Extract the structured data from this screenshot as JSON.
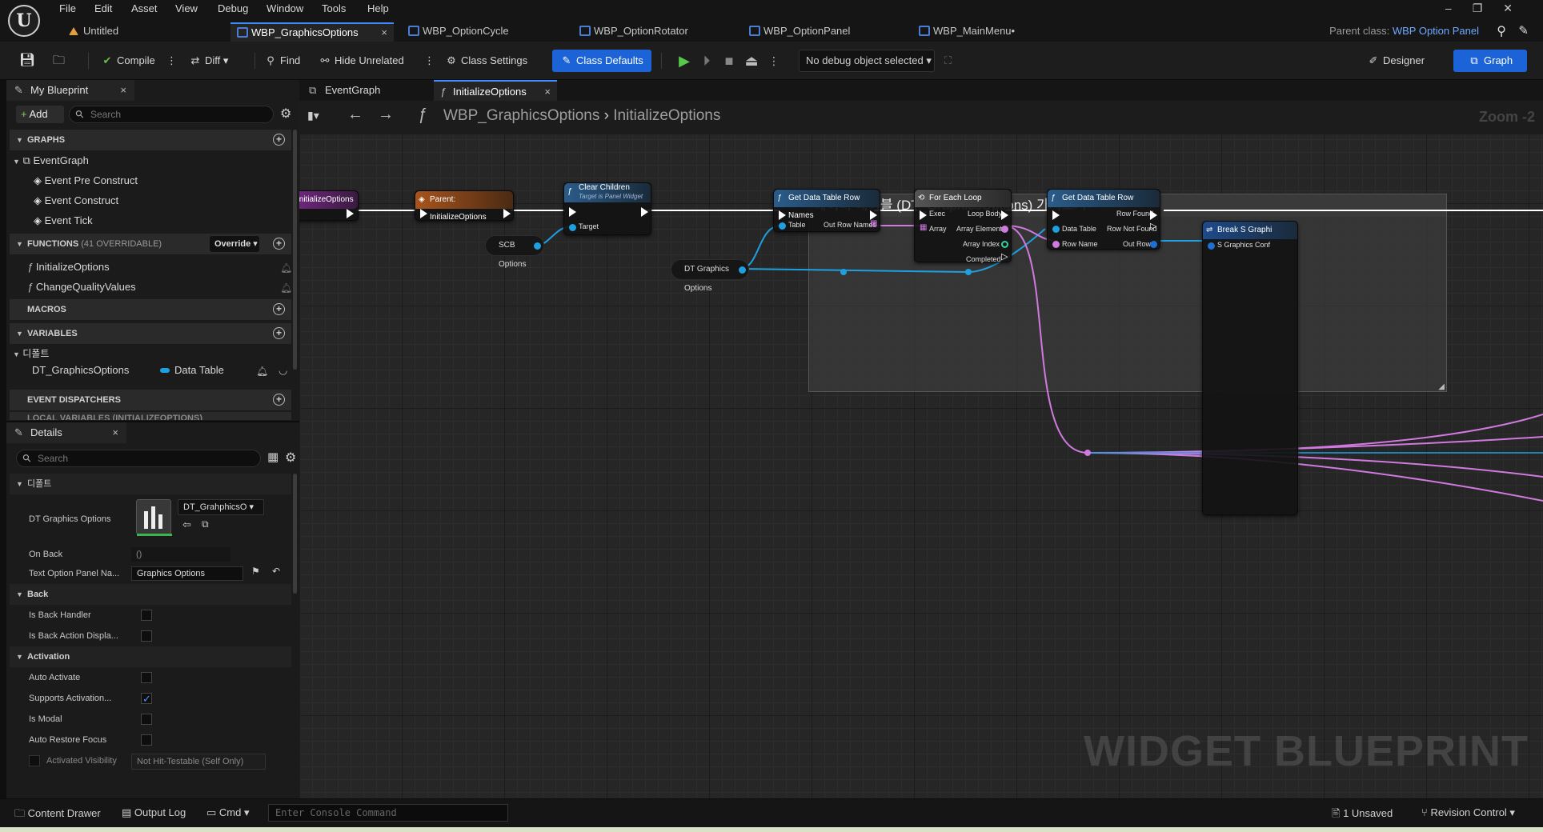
{
  "menu": [
    "File",
    "Edit",
    "Asset",
    "View",
    "Debug",
    "Window",
    "Tools",
    "Help"
  ],
  "doc_tabs": [
    {
      "label": "Untitled"
    },
    {
      "label": "WBP_GraphicsOptions"
    },
    {
      "label": "WBP_OptionCycle"
    },
    {
      "label": "WBP_OptionRotator"
    },
    {
      "label": "WBP_OptionPanel"
    },
    {
      "label": "WBP_MainMenu•"
    }
  ],
  "parent_class": {
    "label": "Parent class:",
    "value": "WBP Option Panel"
  },
  "toolbar": {
    "compile": "Compile",
    "diff": "Diff",
    "find": "Find",
    "hide_unrelated": "Hide Unrelated",
    "class_settings": "Class Settings",
    "class_defaults": "Class Defaults",
    "debug_object": "No debug object selected",
    "designer": "Designer",
    "graph": "Graph"
  },
  "my_blueprint": {
    "tab": "My Blueprint",
    "add": "Add",
    "search_placeholder": "Search",
    "graphs_header": "GRAPHS",
    "event_graph": "EventGraph",
    "events": [
      "Event Pre Construct",
      "Event Construct",
      "Event Tick"
    ],
    "functions_header": "FUNCTIONS",
    "functions_count": "(41 OVERRIDABLE)",
    "override": "Override",
    "functions": [
      "InitializeOptions",
      "ChangeQualityValues"
    ],
    "macros_header": "MACROS",
    "variables_header": "VARIABLES",
    "var_category": "디폴트",
    "variable_name": "DT_GraphicsOptions",
    "variable_type": "Data Table",
    "dispatchers_header": "EVENT DISPATCHERS",
    "local_vars_header": "LOCAL VARIABLES (INITIALIZEOPTIONS)"
  },
  "details": {
    "tab": "Details",
    "search_placeholder": "Search",
    "category_default": "디폴트",
    "dt_graphics_label": "DT Graphics Options",
    "dt_graphics_value": "DT_GrahphicsO",
    "on_back_label": "On Back",
    "on_back_value": "()",
    "text_panel_label": "Text Option Panel Na...",
    "text_panel_value": "Graphics Options",
    "back_header": "Back",
    "is_back_handler": "Is Back Handler",
    "is_back_action": "Is Back Action Displa...",
    "activation_header": "Activation",
    "auto_activate": "Auto Activate",
    "supports_activation": "Supports Activation...",
    "is_modal": "Is Modal",
    "auto_restore": "Auto Restore Focus",
    "activated_visibility": "Activated Visibility",
    "activated_visibility_value": "Not Hit-Testable (Self Only)",
    "checks": {
      "is_back_handler": false,
      "is_back_action": false,
      "auto_activate": false,
      "supports_activation": true,
      "is_modal": false,
      "auto_restore": false
    }
  },
  "graph_tabs": [
    "EventGraph",
    "InitializeOptions"
  ],
  "graph": {
    "breadcrumb_root": "WBP_GraphicsOptions",
    "breadcrumb_leaf": "InitializeOptions",
    "zoom": "Zoom -2",
    "watermark": "WIDGET BLUEPRINT",
    "comment": "데이터 테이블 (DT_GraphicsOptions) 가져오기",
    "nodes": {
      "entry": "InitializeOptions",
      "parent": "Parent: InitializeOptions",
      "clear_children": "Clear Children",
      "clear_children_sub": "Target is Panel Widget",
      "target": "Target",
      "scb_options": "SCB Options",
      "dt_graphics": "DT Graphics Options",
      "get_row_names": "Get Data Table Row Names",
      "table": "Table",
      "out_row_names": "Out Row Names",
      "for_each": "For Each Loop",
      "exec": "Exec",
      "array": "Array",
      "loop_body": "Loop Body",
      "array_element": "Array Element",
      "array_index": "Array Index",
      "completed": "Completed",
      "get_row": "Get Data Table Row",
      "data_table": "Data Table",
      "row_name": "Row Name",
      "row_found": "Row Found",
      "row_not_found": "Row Not Found",
      "out_row": "Out Row",
      "break_struct": "Break S Graphi",
      "break_pin": "S Graphics Conf"
    },
    "colors": {
      "exec": "#ffffff",
      "table": "#1ea0e0",
      "name": "#d07ae0",
      "int": "#35d0a0"
    }
  },
  "statusbar": {
    "content_drawer": "Content Drawer",
    "output_log": "Output Log",
    "cmd": "Cmd",
    "console_placeholder": "Enter Console Command",
    "unsaved": "1 Unsaved",
    "revision_control": "Revision Control"
  }
}
